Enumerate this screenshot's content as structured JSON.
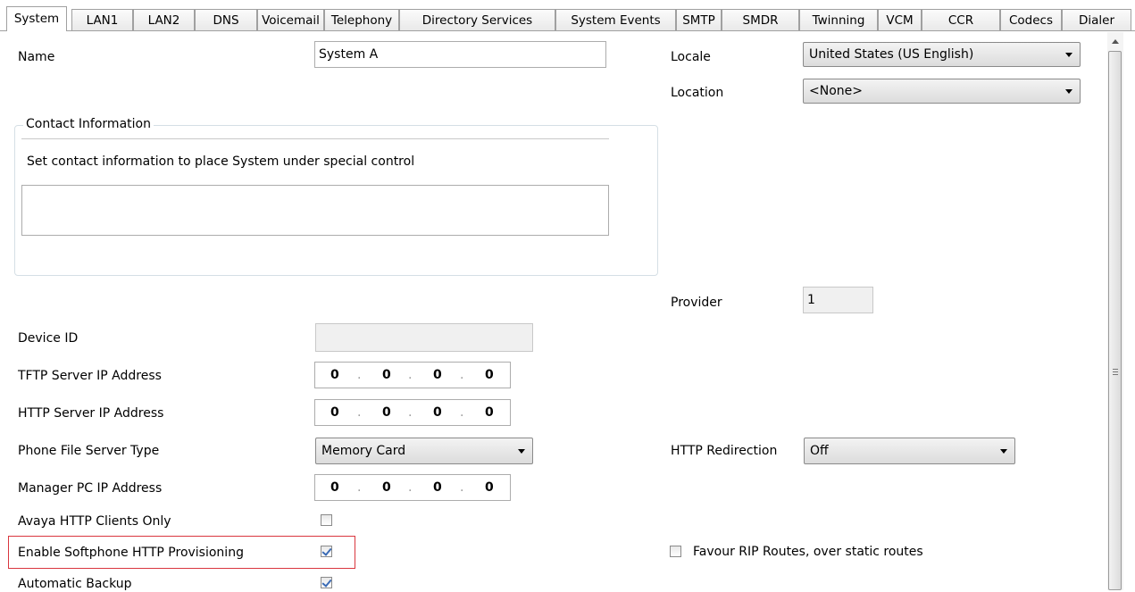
{
  "tabs": [
    {
      "label": "System",
      "active": true
    },
    {
      "label": "LAN1"
    },
    {
      "label": "LAN2"
    },
    {
      "label": "DNS"
    },
    {
      "label": "Voicemail"
    },
    {
      "label": "Telephony"
    },
    {
      "label": "Directory Services"
    },
    {
      "label": "System Events"
    },
    {
      "label": "SMTP"
    },
    {
      "label": "SMDR"
    },
    {
      "label": "Twinning"
    },
    {
      "label": "VCM"
    },
    {
      "label": "CCR"
    },
    {
      "label": "Codecs"
    },
    {
      "label": "Dialer"
    }
  ],
  "form": {
    "name_label": "Name",
    "name_value": "System A",
    "locale_label": "Locale",
    "locale_value": "United States (US English)",
    "location_label": "Location",
    "location_value": "<None>",
    "contact": {
      "title": "Contact Information",
      "checkbox_label": "Set contact information to place System under special control",
      "notes_value": ""
    },
    "provider_label": "Provider",
    "provider_value": "1",
    "device_id_label": "Device ID",
    "device_id_value": "",
    "tftp_label": "TFTP Server IP Address",
    "tftp_ip": [
      "0",
      "0",
      "0",
      "0"
    ],
    "http_label": "HTTP Server IP Address",
    "http_ip": [
      "0",
      "0",
      "0",
      "0"
    ],
    "phone_file_label": "Phone File Server Type",
    "phone_file_value": "Memory Card",
    "http_redirection_label": "HTTP Redirection",
    "http_redirection_value": "Off",
    "manager_pc_label": "Manager PC IP Address",
    "manager_pc_ip": [
      "0",
      "0",
      "0",
      "0"
    ],
    "avaya_http_label": "Avaya HTTP Clients Only",
    "avaya_http_checked": false,
    "softphone_label": "Enable Softphone HTTP Provisioning",
    "softphone_checked": true,
    "favour_rip_label": "Favour RIP Routes, over static routes",
    "favour_rip_checked": false,
    "auto_backup_label": "Automatic Backup",
    "auto_backup_checked": true
  },
  "colors": {
    "highlight": "#d9363e",
    "check": "#3b6bb5"
  }
}
